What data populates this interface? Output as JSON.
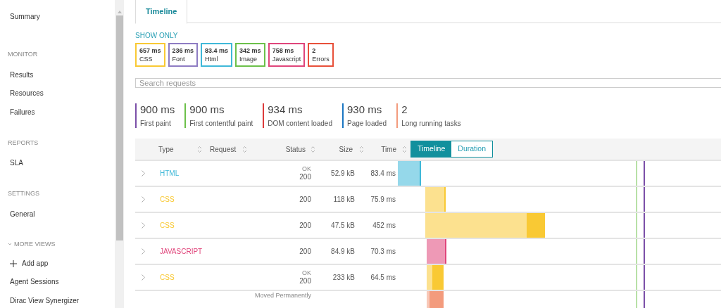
{
  "sidebar": {
    "items": [
      {
        "kind": "link",
        "label": "Summary"
      },
      {
        "kind": "heading",
        "label": "MONITOR"
      },
      {
        "kind": "link",
        "label": "Results"
      },
      {
        "kind": "link",
        "label": "Resources"
      },
      {
        "kind": "link",
        "label": "Failures"
      },
      {
        "kind": "heading",
        "label": "REPORTS"
      },
      {
        "kind": "link",
        "label": "SLA"
      },
      {
        "kind": "heading",
        "label": "SETTINGS"
      },
      {
        "kind": "link",
        "label": "General"
      },
      {
        "kind": "toggle",
        "label": "MORE VIEWS",
        "expanded": true
      },
      {
        "kind": "add",
        "label": "Add app"
      },
      {
        "kind": "link",
        "label": "Agent Sessions"
      },
      {
        "kind": "link",
        "label": "Dirac View Synergizer"
      }
    ]
  },
  "tabs": [
    {
      "label": "Timeline",
      "selected": true
    }
  ],
  "show_only": {
    "label": "SHOW ONLY",
    "filters": [
      {
        "value": "657 ms",
        "label": "CSS",
        "color": "#f9c934"
      },
      {
        "value": "236 ms",
        "label": "Font",
        "color": "#8e7cc3"
      },
      {
        "value": "83.4 ms",
        "label": "Html",
        "color": "#3fb8d8"
      },
      {
        "value": "342 ms",
        "label": "Image",
        "color": "#6cc04a"
      },
      {
        "value": "758 ms",
        "label": "Javascript",
        "color": "#e0457b"
      },
      {
        "value": "2",
        "label": "Errors",
        "color": "#e8503a"
      }
    ]
  },
  "search": {
    "placeholder": "Search requests"
  },
  "metrics": [
    {
      "value": "900 ms",
      "label": "First paint",
      "color": "#7b4fa8"
    },
    {
      "value": "900 ms",
      "label": "First contentful paint",
      "color": "#6cc04a"
    },
    {
      "value": "934 ms",
      "label": "DOM content loaded",
      "color": "#dc3b3b"
    },
    {
      "value": "930 ms",
      "label": "Page loaded",
      "color": "#1a76c2"
    },
    {
      "value": "2",
      "label": "Long running tasks",
      "color": "#f39b7d"
    }
  ],
  "table": {
    "columns": [
      "Type",
      "Request",
      "Status",
      "Size",
      "Time"
    ],
    "view_toggle": [
      {
        "label": "Timeline",
        "selected": true
      },
      {
        "label": "Duration",
        "selected": false
      }
    ],
    "rows": [
      {
        "type": "HTML",
        "color": "#3fb8d8",
        "status_text": "OK",
        "status": "200",
        "size": "52.9 kB",
        "time": "83.4 ms"
      },
      {
        "type": "CSS",
        "color": "#f9c934",
        "status": "200",
        "size": "118 kB",
        "time": "75.9 ms"
      },
      {
        "type": "CSS",
        "color": "#f9c934",
        "status": "200",
        "size": "47.5 kB",
        "time": "452 ms"
      },
      {
        "type": "JAVASCRIPT",
        "color": "#e0457b",
        "status": "200",
        "size": "84.9 kB",
        "time": "70.3 ms"
      },
      {
        "type": "CSS",
        "color": "#f9c934",
        "status_text": "OK",
        "status": "200",
        "size": "233 kB",
        "time": "64.5 ms"
      },
      {
        "color": "#f39b7d",
        "status_text": "Moved Permanently"
      }
    ]
  }
}
